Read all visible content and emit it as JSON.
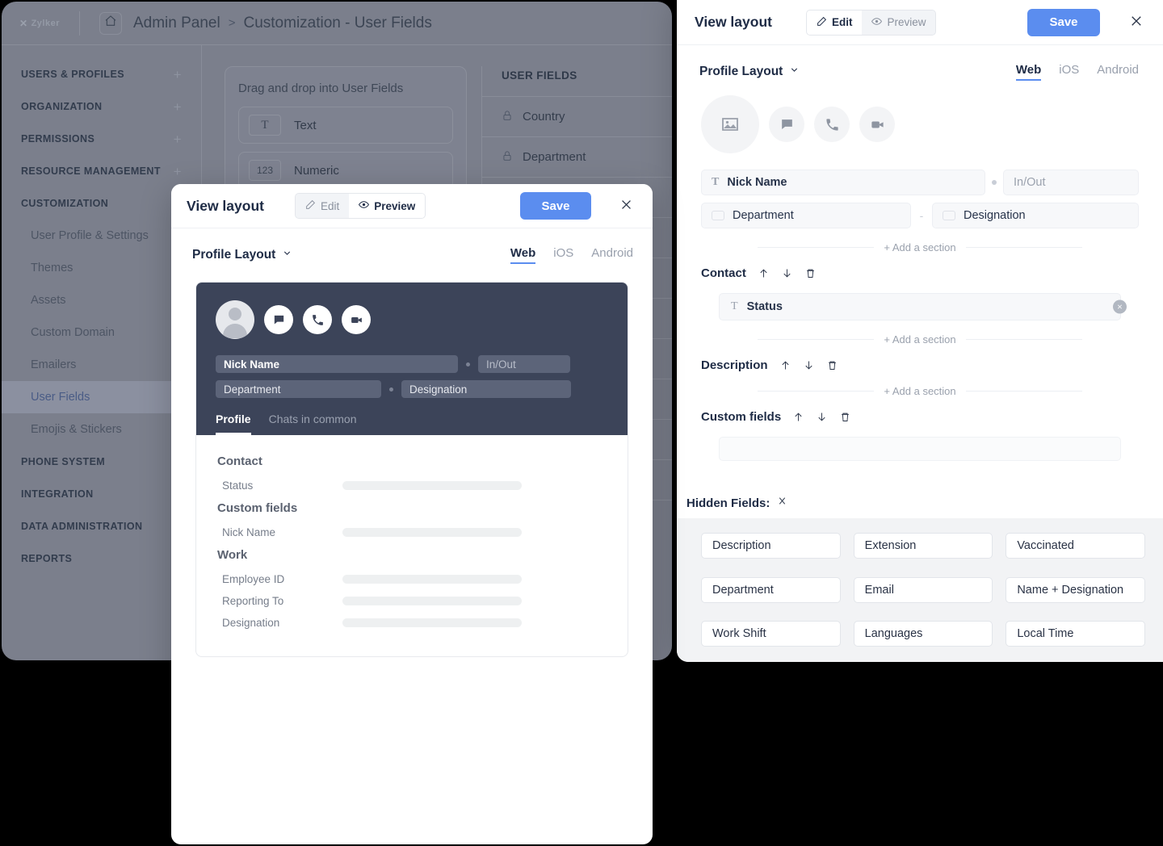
{
  "background": {
    "logo": "Zylker",
    "breadcrumb": {
      "home_icon": "home-icon",
      "root": "Admin Panel",
      "sep": ">",
      "current": "Customization - User Fields"
    },
    "sidebar_groups": [
      {
        "label": "USERS & PROFILES",
        "plus": "+"
      },
      {
        "label": "ORGANIZATION",
        "plus": "+"
      },
      {
        "label": "PERMISSIONS",
        "plus": "+"
      },
      {
        "label": "RESOURCE MANAGEMENT",
        "plus": "+"
      },
      {
        "label": "CUSTOMIZATION",
        "plus": ""
      }
    ],
    "sidebar_sub": [
      {
        "label": "User Profile & Settings",
        "active": false
      },
      {
        "label": "Themes",
        "active": false
      },
      {
        "label": "Assets",
        "active": false
      },
      {
        "label": "Custom Domain",
        "active": false
      },
      {
        "label": "Emailers",
        "active": false
      },
      {
        "label": "User Fields",
        "active": true
      },
      {
        "label": "Emojis & Stickers",
        "active": false
      }
    ],
    "sidebar_groups_2": [
      {
        "label": "PHONE SYSTEM"
      },
      {
        "label": "INTEGRATION"
      },
      {
        "label": "DATA ADMINISTRATION"
      },
      {
        "label": "REPORTS"
      }
    ],
    "dragdrop_title": "Drag and drop into User Fields",
    "field_types": [
      {
        "badge": "T",
        "label": "Text",
        "serif": true
      },
      {
        "badge": "123",
        "label": "Numeric",
        "serif": false
      }
    ],
    "user_fields_header": "USER FIELDS",
    "user_fields_rows": [
      {
        "icon": "lock-icon",
        "label": "Country"
      },
      {
        "icon": "lock-icon",
        "label": "Department"
      },
      {
        "icon": "lock-icon",
        "label": ""
      },
      {
        "icon": "lock-icon",
        "label": ""
      },
      {
        "icon": "lock-icon",
        "label": ""
      },
      {
        "icon": "lock-icon",
        "label": ""
      },
      {
        "icon": "lock-icon",
        "label": ""
      },
      {
        "icon": "lock-icon",
        "label": ""
      },
      {
        "icon": "lock-icon",
        "label": ""
      },
      {
        "icon": "lock-icon",
        "label": ""
      }
    ]
  },
  "colors": {
    "accent_blue": "#5b8def",
    "dark_card": "#3c4459",
    "backdrop_gray": "#7b7f8c",
    "hidden_panel": "#f2f3f5"
  },
  "modal_preview": {
    "title": "View layout",
    "toggle": {
      "edit_label": "Edit",
      "preview_label": "Preview",
      "active": "Preview",
      "edit_icon": "pencil-icon",
      "preview_icon": "eye-icon"
    },
    "save_label": "Save",
    "close_icon": "close-icon",
    "layout_select": {
      "label": "Profile Layout",
      "chevron_icon": "chevron-down-icon"
    },
    "platforms": [
      {
        "label": "Web",
        "active": true
      },
      {
        "label": "iOS",
        "active": false
      },
      {
        "label": "Android",
        "active": false
      }
    ],
    "card": {
      "avatar_icon": "avatar-icon",
      "action_icons": [
        "chat-icon",
        "phone-icon",
        "video-icon"
      ],
      "row1": {
        "primary": "Nick Name",
        "secondary": "In/Out"
      },
      "row2": {
        "primary": "Department",
        "secondary": "Designation"
      },
      "tabs": [
        {
          "label": "Profile",
          "active": true
        },
        {
          "label": "Chats in common",
          "active": false
        }
      ]
    },
    "sections": [
      {
        "heading": "Contact",
        "fields": [
          "Status"
        ]
      },
      {
        "heading": "Custom fields",
        "fields": [
          "Nick Name"
        ]
      },
      {
        "heading": "Work",
        "fields": [
          "Employee ID",
          "Reporting To",
          "Designation"
        ]
      }
    ]
  },
  "modal_edit": {
    "title": "View layout",
    "toggle": {
      "edit_label": "Edit",
      "preview_label": "Preview",
      "active": "Edit",
      "edit_icon": "pencil-icon",
      "preview_icon": "eye-icon"
    },
    "save_label": "Save",
    "close_icon": "close-icon",
    "layout_select": {
      "label": "Profile Layout",
      "chevron_icon": "chevron-down-icon"
    },
    "platforms": [
      {
        "label": "Web",
        "active": true
      },
      {
        "label": "iOS",
        "active": false
      },
      {
        "label": "Android",
        "active": false
      }
    ],
    "header_block": {
      "avatar_icon": "image-placeholder-icon",
      "action_icons": [
        "chat-icon",
        "phone-icon",
        "video-icon"
      ],
      "row1": {
        "type_icon": "text-type-icon",
        "primary": "Nick Name",
        "separator": "dot",
        "secondary": "In/Out"
      },
      "row2": {
        "type_icon": "dropdown-type-icon",
        "primary": "Department",
        "separator": "-",
        "secondary_type_icon": "dropdown-type-icon",
        "secondary": "Designation"
      }
    },
    "add_section_label": "+ Add a section",
    "sections": [
      {
        "name": "Contact",
        "controls": [
          "move-up-icon",
          "move-down-icon",
          "delete-icon"
        ],
        "fields": [
          {
            "type_icon": "text-type-icon",
            "label": "Status",
            "remove_icon": "remove-field-icon"
          }
        ]
      },
      {
        "name": "Description",
        "controls": [
          "move-up-icon",
          "move-down-icon",
          "delete-icon"
        ],
        "fields": []
      },
      {
        "name": "Custom fields",
        "controls": [
          "move-up-icon",
          "move-down-icon",
          "delete-icon"
        ],
        "fields": []
      }
    ],
    "hidden_fields": {
      "label": "Hidden Fields:",
      "collapse_icon": "collapse-icon",
      "chips": [
        "Description",
        "Extension",
        "Vaccinated",
        "Department",
        "Email",
        "Name + Designation",
        "Work Shift",
        "Languages",
        "Local Time"
      ]
    }
  }
}
